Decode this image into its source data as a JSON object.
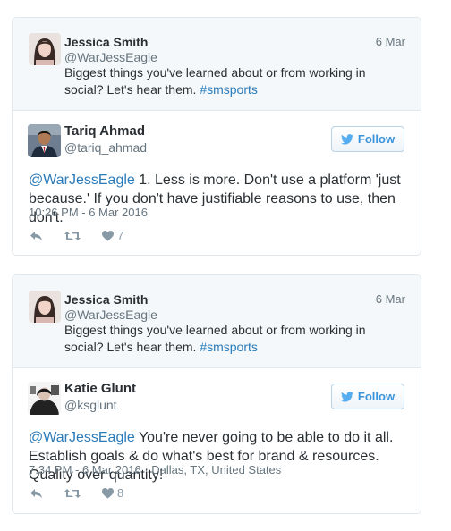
{
  "tweets": [
    {
      "parent": {
        "name": "Jessica Smith",
        "handle": "@WarJessEagle",
        "date": "6 Mar",
        "text": "Biggest things you've learned about or from working in social? Let's hear them. ",
        "hashtag": "#smsports"
      },
      "reply": {
        "name": "Tariq Ahmad",
        "handle": "@tariq_ahmad",
        "follow_label": "Follow",
        "mention": "@WarJessEagle",
        "text": " 1. Less is more. Don't use a platform 'just because.' If you don't have justifiable reasons to use, then don't.",
        "meta": "10:26 PM - 6 Mar 2016",
        "like_count": "7"
      }
    },
    {
      "parent": {
        "name": "Jessica Smith",
        "handle": "@WarJessEagle",
        "date": "6 Mar",
        "text": "Biggest things you've learned about or from working in social? Let's hear them. ",
        "hashtag": "#smsports"
      },
      "reply": {
        "name": "Katie Glunt",
        "handle": "@ksglunt",
        "follow_label": "Follow",
        "mention": "@WarJessEagle",
        "text": " You're never going to be able to do it all. Establish goals & do what's best for brand & resources. Quality over quantity!",
        "meta": "7:34 PM - 6 Mar 2016 · Dallas, TX, United States",
        "like_count": "8"
      }
    }
  ],
  "colors": {
    "link": "#2b7bb9",
    "follow": "#3b94d9",
    "muted": "#66757f",
    "icon": "#8899a6"
  }
}
